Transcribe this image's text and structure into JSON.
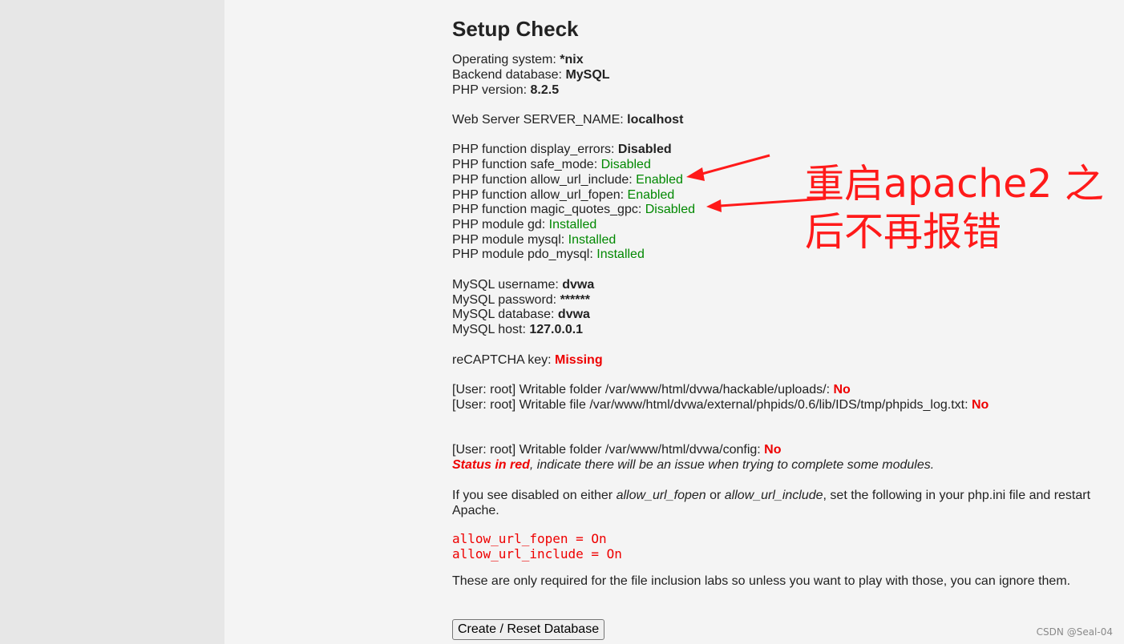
{
  "title": "Setup Check",
  "system": [
    {
      "label": "Operating system: ",
      "value": "*nix"
    },
    {
      "label": "Backend database: ",
      "value": "MySQL"
    },
    {
      "label": "PHP version: ",
      "value": "8.2.5"
    }
  ],
  "server": {
    "label": "Web Server SERVER_NAME: ",
    "value": "localhost"
  },
  "php_checks": [
    {
      "label": "PHP function display_errors: ",
      "value": "Disabled",
      "status": "bold"
    },
    {
      "label": "PHP function safe_mode: ",
      "value": "Disabled",
      "status": "green"
    },
    {
      "label": "PHP function allow_url_include: ",
      "value": "Enabled",
      "status": "green"
    },
    {
      "label": "PHP function allow_url_fopen: ",
      "value": "Enabled",
      "status": "green"
    },
    {
      "label": "PHP function magic_quotes_gpc: ",
      "value": "Disabled",
      "status": "green"
    },
    {
      "label": "PHP module gd: ",
      "value": "Installed",
      "status": "green"
    },
    {
      "label": "PHP module mysql: ",
      "value": "Installed",
      "status": "green"
    },
    {
      "label": "PHP module pdo_mysql: ",
      "value": "Installed",
      "status": "green"
    }
  ],
  "mysql": [
    {
      "label": "MySQL username: ",
      "value": "dvwa"
    },
    {
      "label": "MySQL password: ",
      "value": "******"
    },
    {
      "label": "MySQL database: ",
      "value": "dvwa"
    },
    {
      "label": "MySQL host: ",
      "value": "127.0.0.1"
    }
  ],
  "recaptcha": {
    "label": "reCAPTCHA key: ",
    "value": "Missing"
  },
  "writable": [
    {
      "label": "[User: root] Writable folder /var/www/html/dvwa/hackable/uploads/: ",
      "value": "No"
    },
    {
      "label": "[User: root] Writable file /var/www/html/dvwa/external/phpids/0.6/lib/IDS/tmp/phpids_log.txt: ",
      "value": "No"
    }
  ],
  "config_folder": {
    "label": "[User: root] Writable folder /var/www/html/dvwa/config: ",
    "value": "No"
  },
  "status_note": {
    "bold": "Status in red",
    "rest": ", indicate there will be an issue when trying to complete some modules."
  },
  "fopen_note": {
    "p1": "If you see disabled on either ",
    "em1": "allow_url_fopen",
    "p2": " or ",
    "em2": "allow_url_include",
    "p3": ", set the following in your php.ini file and restart Apache."
  },
  "code_lines": [
    "allow_url_fopen = On",
    "allow_url_include = On"
  ],
  "labs_note": "These are only required for the file inclusion labs so unless you want to play with those, you can ignore them.",
  "button_label": "Create / Reset Database",
  "annotation": {
    "line1": "重启apache2 之",
    "line2": "后不再报错",
    "color": "#ff1a1a"
  },
  "watermark": "CSDN @Seal-04",
  "colors": {
    "green": "#008800",
    "red": "#ee0000",
    "background": "#f4f4f4"
  }
}
